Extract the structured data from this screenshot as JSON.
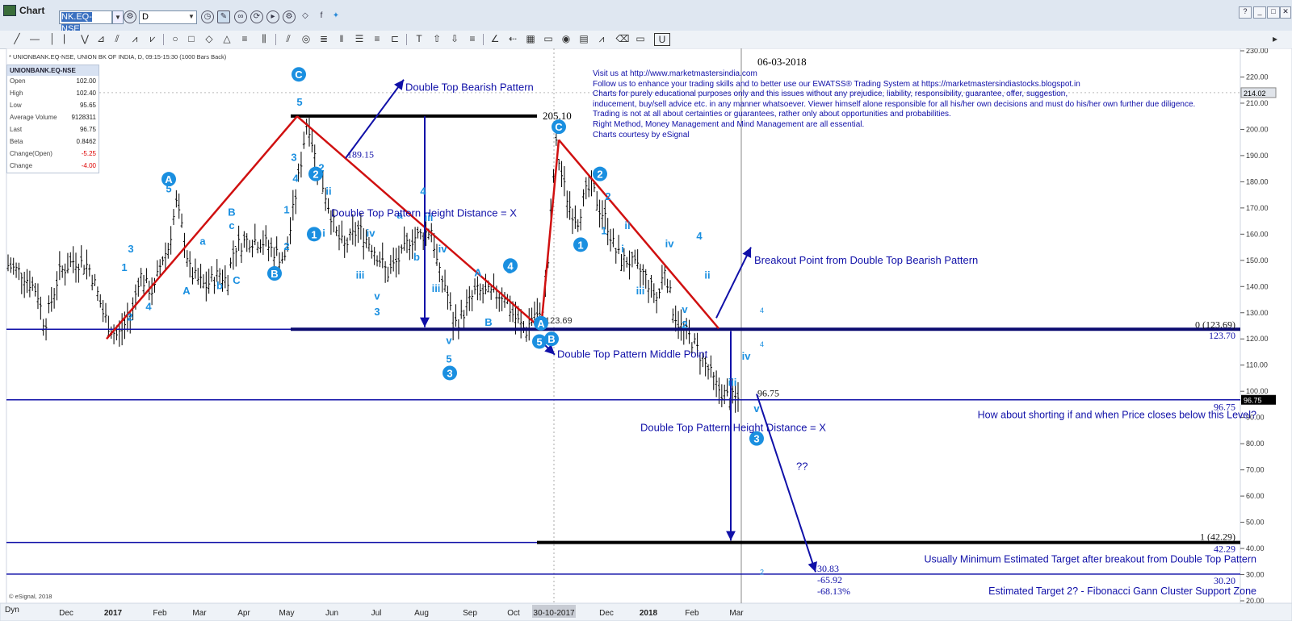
{
  "window": {
    "title": "Chart",
    "symbol_value": "NK.EQ-NSE",
    "interval_value": "D"
  },
  "chart_header": "* UNIONBANK.EQ-NSE, UNION BK OF INDIA, D, 09:15-15:30 (1000 Bars Back)",
  "info_panel": {
    "symbol": "UNIONBANK.EQ-NSE",
    "rows": [
      {
        "label": "Open",
        "value": "102.00"
      },
      {
        "label": "High",
        "value": "102.40"
      },
      {
        "label": "Low",
        "value": "95.65"
      },
      {
        "label": "Average Volume",
        "value": "9128311"
      },
      {
        "label": "Last",
        "value": "96.75"
      },
      {
        "label": "Beta",
        "value": "0.8462"
      },
      {
        "label": "Change(Open)",
        "value": "-5.25"
      },
      {
        "label": "Change",
        "value": "-4.00"
      }
    ]
  },
  "notes": [
    "Visit us at http://www.marketmastersindia.com",
    "Follow us to enhance your trading skills and to better use our EWATSS® Trading System at https://marketmastersindiastocks.blogspot.in",
    "Charts for purely educational purposes only and this issues without any prejudice, liability, responsibility, guarantee, offer, suggestion,",
    "inducement, buy/sell advice etc. in any manner whatsoever. Viewer himself alone responsible for all his/her own decisions and must do his/her own further due diligence.",
    "Trading is not at all about certainties or guarantees, rather only about opportunities and probabilities.",
    "Right Method, Money Management and Mind Management are all essential.",
    "Charts courtesy by eSignal"
  ],
  "current_date": "06-03-2018",
  "copyright": "© eSignal, 2018",
  "dyn_label": "Dyn",
  "colors": {
    "bars": "#000000",
    "pattern": "#d01010",
    "levels": "#1010a8",
    "waves": "#1a8fe0",
    "black_level": "#000000"
  },
  "chart_data": {
    "type": "candlestick",
    "y_axis": {
      "min": 20,
      "max": 230,
      "ticks": [
        "230.00",
        "220.00",
        "210.00",
        "200.00",
        "190.00",
        "180.00",
        "170.00",
        "160.00",
        "150.00",
        "140.00",
        "130.00",
        "120.00",
        "110.00",
        "100.00",
        "90.00",
        "80.00",
        "70.00",
        "60.00",
        "50.00",
        "40.00",
        "30.00",
        "20.00"
      ],
      "position": "right"
    },
    "x_axis": {
      "labels": [
        "Dec",
        "2017",
        "Feb",
        "Mar",
        "Apr",
        "May",
        "Jun",
        "Jul",
        "Aug",
        "Sep",
        "Oct",
        "30-10-2017",
        "Dec",
        "2018",
        "Feb",
        "Mar"
      ]
    },
    "price_path": [
      [
        0,
        148
      ],
      [
        0.02,
        145
      ],
      [
        0.04,
        138
      ],
      [
        0.05,
        125
      ],
      [
        0.07,
        145
      ],
      [
        0.09,
        150
      ],
      [
        0.11,
        148
      ],
      [
        0.12,
        140
      ],
      [
        0.13,
        130
      ],
      [
        0.14,
        124
      ],
      [
        0.15,
        121
      ],
      [
        0.17,
        130
      ],
      [
        0.18,
        145
      ],
      [
        0.19,
        140
      ],
      [
        0.2,
        138
      ],
      [
        0.21,
        150
      ],
      [
        0.22,
        155
      ],
      [
        0.23,
        172
      ],
      [
        0.24,
        160
      ],
      [
        0.25,
        145
      ],
      [
        0.27,
        140
      ],
      [
        0.29,
        145
      ],
      [
        0.3,
        142
      ],
      [
        0.31,
        155
      ],
      [
        0.33,
        158
      ],
      [
        0.35,
        157
      ],
      [
        0.37,
        152
      ],
      [
        0.38,
        150
      ],
      [
        0.39,
        168
      ],
      [
        0.4,
        185
      ],
      [
        0.41,
        205
      ],
      [
        0.42,
        190
      ],
      [
        0.43,
        180
      ],
      [
        0.44,
        170
      ],
      [
        0.45,
        160
      ],
      [
        0.46,
        155
      ],
      [
        0.48,
        162
      ],
      [
        0.5,
        155
      ],
      [
        0.52,
        145
      ],
      [
        0.54,
        152
      ],
      [
        0.55,
        158
      ],
      [
        0.57,
        160
      ],
      [
        0.58,
        162
      ],
      [
        0.59,
        145
      ],
      [
        0.6,
        140
      ],
      [
        0.61,
        125
      ],
      [
        0.62,
        128
      ],
      [
        0.64,
        138
      ],
      [
        0.66,
        137
      ],
      [
        0.68,
        137
      ],
      [
        0.69,
        130
      ],
      [
        0.7,
        126
      ],
      [
        0.71,
        123
      ],
      [
        0.72,
        130
      ],
      [
        0.73,
        127
      ],
      [
        0.74,
        150
      ],
      [
        0.75,
        195
      ],
      [
        0.76,
        180
      ],
      [
        0.77,
        170
      ],
      [
        0.78,
        165
      ],
      [
        0.79,
        175
      ],
      [
        0.8,
        178
      ],
      [
        0.81,
        170
      ],
      [
        0.82,
        165
      ],
      [
        0.83,
        155
      ],
      [
        0.84,
        150
      ],
      [
        0.85,
        150
      ],
      [
        0.86,
        147
      ],
      [
        0.87,
        145
      ],
      [
        0.88,
        140
      ],
      [
        0.89,
        135
      ],
      [
        0.9,
        148
      ],
      [
        0.91,
        132
      ],
      [
        0.92,
        125
      ],
      [
        0.93,
        122
      ],
      [
        0.94,
        118
      ],
      [
        0.95,
        113
      ],
      [
        0.96,
        108
      ],
      [
        0.97,
        102
      ],
      [
        0.98,
        99
      ],
      [
        0.99,
        97
      ]
    ],
    "price_labels": [
      {
        "text": "205.10",
        "value": 205.1
      },
      {
        "text": "189.15",
        "value": 189.15
      },
      {
        "text": "123.69",
        "value": 123.69
      },
      {
        "text": "123.70",
        "value": 123.7
      },
      {
        "text": "96.75",
        "value": 96.75
      },
      {
        "text": "42.29",
        "value": 42.29
      },
      {
        "text": "30.20",
        "value": 30.2
      },
      {
        "text": "30.83",
        "value": 30.83
      }
    ],
    "levels": [
      {
        "name": "Double Top Pattern Middle Point",
        "value": 123.69,
        "label": "0 (123.69)"
      },
      {
        "name": "Current Price",
        "value": 96.75
      },
      {
        "name": "Target 1",
        "value": 42.29,
        "label": "1 (42.29)"
      },
      {
        "name": "Target 2",
        "value": 30.2
      }
    ],
    "annotations": [
      "Double Top Bearish Pattern",
      "Double Top Pattern Height Distance = X",
      "Double Top Pattern Middle Point",
      "Breakout Point from Double Top Bearish Pattern",
      "How about shorting if and when Price closes below this Level?",
      "Usually Minimum Estimated Target after breakout from Double Top Pattern",
      "Estimated Target 2? - Fibonacci Gann Cluster Support Zone",
      "??",
      "-65.92",
      "-68.13%"
    ],
    "axis_marker_last": "96.75",
    "axis_marker_top": "214.02",
    "small_labels": [
      "4",
      "4",
      "2"
    ],
    "grid": false
  }
}
